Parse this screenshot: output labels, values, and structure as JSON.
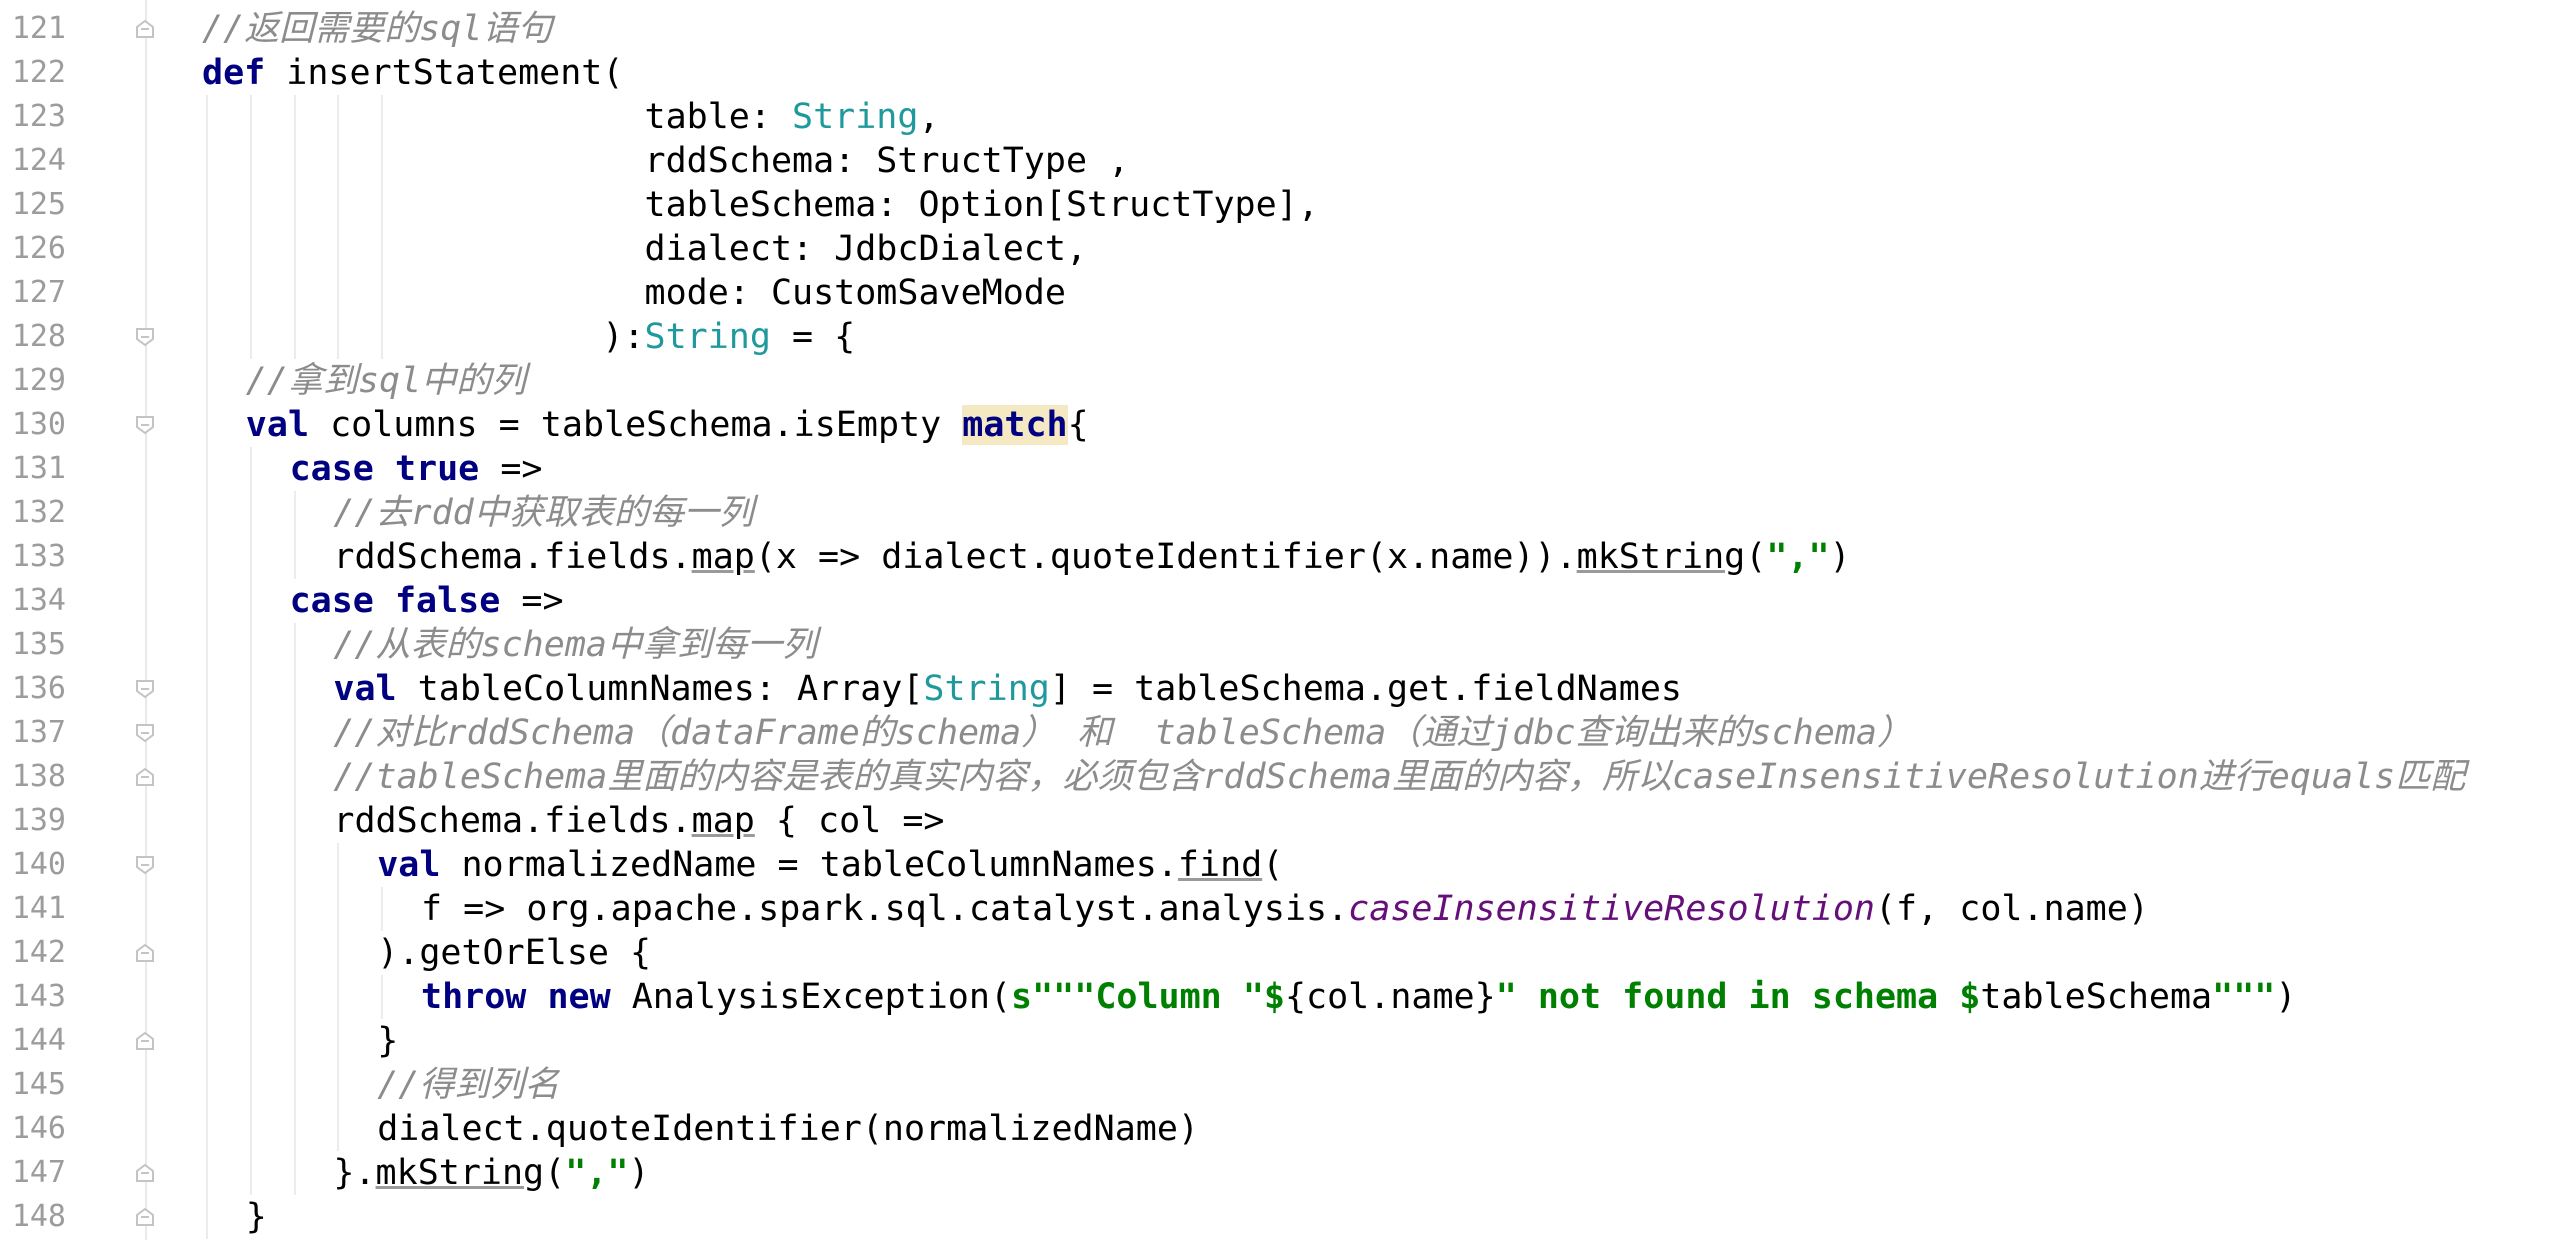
{
  "editor": {
    "line_numbers": [
      "121",
      "122",
      "123",
      "124",
      "125",
      "126",
      "127",
      "128",
      "129",
      "130",
      "131",
      "132",
      "133",
      "134",
      "135",
      "136",
      "137",
      "138",
      "139",
      "140",
      "141",
      "142",
      "143",
      "144",
      "145",
      "146",
      "147",
      "148"
    ],
    "lines": [
      {
        "indent": 0,
        "tokens": [
          {
            "t": "//返回需要的sql语句",
            "s": "c-cmt"
          }
        ]
      },
      {
        "indent": 0,
        "tokens": [
          {
            "t": "def",
            "s": "c-kw"
          },
          {
            "t": " insertStatement(",
            "s": ""
          }
        ]
      },
      {
        "indent": 0,
        "tokens": [
          {
            "t": "                     table: ",
            "s": ""
          },
          {
            "t": "String",
            "s": "c-type"
          },
          {
            "t": ",",
            "s": ""
          }
        ]
      },
      {
        "indent": 0,
        "tokens": [
          {
            "t": "                     rddSchema: StructType ,",
            "s": ""
          }
        ]
      },
      {
        "indent": 0,
        "tokens": [
          {
            "t": "                     tableSchema: Option[StructType],",
            "s": ""
          }
        ]
      },
      {
        "indent": 0,
        "tokens": [
          {
            "t": "                     dialect: JdbcDialect,",
            "s": ""
          }
        ]
      },
      {
        "indent": 0,
        "tokens": [
          {
            "t": "                     mode: CustomSaveMode",
            "s": ""
          }
        ]
      },
      {
        "indent": 0,
        "tokens": [
          {
            "t": "                   ):",
            "s": ""
          },
          {
            "t": "String",
            "s": "c-type"
          },
          {
            "t": " = {",
            "s": ""
          }
        ]
      },
      {
        "indent": 2,
        "tokens": [
          {
            "t": "//拿到sql中的列",
            "s": "c-cmt"
          }
        ]
      },
      {
        "indent": 2,
        "tokens": [
          {
            "t": "val",
            "s": "c-kw"
          },
          {
            "t": " columns = tableSchema.isEmpty ",
            "s": ""
          },
          {
            "t": "match",
            "s": "c-kw c-hl"
          },
          {
            "t": "{",
            "s": ""
          }
        ]
      },
      {
        "indent": 4,
        "tokens": [
          {
            "t": "case",
            "s": "c-kw"
          },
          {
            "t": " ",
            "s": ""
          },
          {
            "t": "true",
            "s": "c-kw"
          },
          {
            "t": " =>",
            "s": ""
          }
        ]
      },
      {
        "indent": 6,
        "tokens": [
          {
            "t": "//去rdd中获取表的每一列",
            "s": "c-cmt"
          }
        ]
      },
      {
        "indent": 6,
        "tokens": [
          {
            "t": "rddSchema.fields.",
            "s": ""
          },
          {
            "t": "map",
            "s": "c-ul"
          },
          {
            "t": "(x => dialect.quoteIdentifier(x.name)).",
            "s": ""
          },
          {
            "t": "mkString",
            "s": "c-ul"
          },
          {
            "t": "(",
            "s": ""
          },
          {
            "t": "\",\"",
            "s": "c-str"
          },
          {
            "t": ")",
            "s": ""
          }
        ]
      },
      {
        "indent": 4,
        "tokens": [
          {
            "t": "case",
            "s": "c-kw"
          },
          {
            "t": " ",
            "s": ""
          },
          {
            "t": "false",
            "s": "c-kw"
          },
          {
            "t": " =>",
            "s": ""
          }
        ]
      },
      {
        "indent": 6,
        "tokens": [
          {
            "t": "//从表的schema中拿到每一列",
            "s": "c-cmt"
          }
        ]
      },
      {
        "indent": 6,
        "tokens": [
          {
            "t": "val",
            "s": "c-kw"
          },
          {
            "t": " tableColumnNames: Array[",
            "s": ""
          },
          {
            "t": "String",
            "s": "c-type"
          },
          {
            "t": "] = tableSchema.get.fieldNames",
            "s": ""
          }
        ]
      },
      {
        "indent": 6,
        "tokens": [
          {
            "t": "//对比rddSchema（dataFrame的schema） 和  tableSchema（通过jdbc查询出来的schema）",
            "s": "c-cmt"
          }
        ]
      },
      {
        "indent": 6,
        "tokens": [
          {
            "t": "//tableSchema里面的内容是表的真实内容，必须包含rddSchema里面的内容，所以caseInsensitiveResolution进行equals匹配",
            "s": "c-cmt"
          }
        ]
      },
      {
        "indent": 6,
        "tokens": [
          {
            "t": "rddSchema.fields.",
            "s": ""
          },
          {
            "t": "map",
            "s": "c-ul"
          },
          {
            "t": " { col =>",
            "s": ""
          }
        ]
      },
      {
        "indent": 8,
        "tokens": [
          {
            "t": "val",
            "s": "c-kw"
          },
          {
            "t": " normalizedName = tableColumnNames.",
            "s": ""
          },
          {
            "t": "find",
            "s": "c-ul"
          },
          {
            "t": "(",
            "s": ""
          }
        ]
      },
      {
        "indent": 10,
        "tokens": [
          {
            "t": "f => org.apache.spark.sql.catalyst.analysis.",
            "s": ""
          },
          {
            "t": "caseInsensitiveResolution",
            "s": "c-fn"
          },
          {
            "t": "(f, col.name)",
            "s": ""
          }
        ]
      },
      {
        "indent": 8,
        "tokens": [
          {
            "t": ").getOrElse {",
            "s": ""
          }
        ]
      },
      {
        "indent": 10,
        "tokens": [
          {
            "t": "throw",
            "s": "c-kw"
          },
          {
            "t": " ",
            "s": ""
          },
          {
            "t": "new",
            "s": "c-kw"
          },
          {
            "t": " AnalysisException(",
            "s": ""
          },
          {
            "t": "s\"\"\"Column \"$",
            "s": "c-str"
          },
          {
            "t": "{col.name}",
            "s": ""
          },
          {
            "t": "\" not found in schema $",
            "s": "c-str"
          },
          {
            "t": "tableSchema",
            "s": ""
          },
          {
            "t": "\"\"\"",
            "s": "c-str"
          },
          {
            "t": ")",
            "s": ""
          }
        ]
      },
      {
        "indent": 8,
        "tokens": [
          {
            "t": "}",
            "s": ""
          }
        ]
      },
      {
        "indent": 8,
        "tokens": [
          {
            "t": "//得到列名",
            "s": "c-cmt"
          }
        ]
      },
      {
        "indent": 8,
        "tokens": [
          {
            "t": "dialect.quoteIdentifier(normalizedName)",
            "s": ""
          }
        ]
      },
      {
        "indent": 6,
        "tokens": [
          {
            "t": "}.",
            "s": ""
          },
          {
            "t": "mkString",
            "s": "c-ul"
          },
          {
            "t": "(",
            "s": ""
          },
          {
            "t": "\",\"",
            "s": "c-str"
          },
          {
            "t": ")",
            "s": ""
          }
        ]
      },
      {
        "indent": 2,
        "tokens": [
          {
            "t": "}",
            "s": ""
          }
        ]
      }
    ],
    "fold_markers": [
      {
        "line": 0,
        "kind": "end"
      },
      {
        "line": 7,
        "kind": "start"
      },
      {
        "line": 9,
        "kind": "start"
      },
      {
        "line": 15,
        "kind": "start"
      },
      {
        "line": 16,
        "kind": "start"
      },
      {
        "line": 17,
        "kind": "end"
      },
      {
        "line": 19,
        "kind": "start"
      },
      {
        "line": 21,
        "kind": "end"
      },
      {
        "line": 23,
        "kind": "end"
      },
      {
        "line": 26,
        "kind": "end"
      },
      {
        "line": 27,
        "kind": "end"
      }
    ],
    "colors": {
      "keyword": "#000080",
      "type": "#20999d",
      "string": "#008000",
      "comment": "#8c8c8c",
      "static_method": "#660e7a",
      "match_highlight": "#f5e9c3"
    }
  }
}
